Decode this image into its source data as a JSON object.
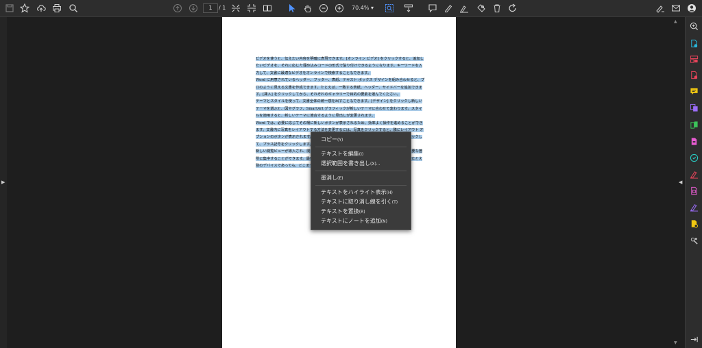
{
  "toolbar": {
    "page_current": "1",
    "page_total": "/ 1",
    "zoom_level": "70.4%",
    "zoom_caret": "▾"
  },
  "document": {
    "paragraphs": [
      "ビデオを使うと、伝えたい内容を明確に表現できます。[オンライン ビデオ] をクリックすると、追加したいビデオを、それに応じた埋め込みコードの形式で貼り付けできるようになります。キーワードを入力して、文書に最適なビデオをオンラインで検索することもできます。",
      "Word に用意されているヘッダー、フッター、表紙、テキスト ボックス デザインを組み合わせると、プロのように見える文書を作成できます。たとえば、一致する表紙、ヘッダー、サイドバーを追加できます。[挿入] をクリックしてから、それぞれのギャラリーで目的の要素を選んでください。",
      "テーマとスタイルを使って、文書全体の統一感を出すこともできます。[デザイン] をクリックし新しいテーマを選ぶと、図やグラフ、SmartArt グラフィックが新しいテーマに合わせて変わります。スタイルを適用すると、新しいテーマに適合するように見出しが変更されます。",
      "Word では、必要に応じてその場に新しいボタンが表示されるため、効率よく操作を進めることができます。文書内に写真をレイアウトする方法を変更するには、写真をクリックすると、隣にレイアウト オプションのボタンが表示されます。表で作業している場合は、行または列を追加する場所をクリックして、プラス記号をクリックします。",
      "新しい閲覧ビューが導入され、閲覧もさらに便利になりました。文書の一部を折りたたんで、必要な箇所に集中することができます。最後まで読み終わる前に中止する必要がある場合、Word では、たとえ別のデバイスであっても、どこまで読んだかが記憶されます。"
    ]
  },
  "context_menu": {
    "items": [
      {
        "label": "コピー",
        "accel": "(Y)"
      },
      {
        "label": "テキストを編集",
        "accel": "(I)"
      },
      {
        "label": "選択範囲を書き出し",
        "accel": "(X)..."
      },
      {
        "label": "墨消し",
        "accel": "(E)"
      },
      {
        "label": "テキストをハイライト表示",
        "accel": "(H)"
      },
      {
        "label": "テキストに取り消し線を引く",
        "accel": "(T)"
      },
      {
        "label": "テキストを置換",
        "accel": "(R)"
      },
      {
        "label": "テキストにノートを追加",
        "accel": "(N)"
      }
    ]
  },
  "colors": {
    "selection": "#a9cbe8",
    "accent": "#4f93ff",
    "toolbar_bg": "#2d2d2d"
  },
  "icons": {
    "left_toolbar": [
      "save-icon",
      "star-icon",
      "cloud-upload-icon",
      "print-icon",
      "search-icon"
    ],
    "right_panel": [
      "zoom-icon",
      "export-pdf-icon",
      "edit-pdf-icon",
      "create-pdf-icon",
      "comment-icon",
      "combine-icon",
      "organize-icon",
      "compress-icon",
      "protect-icon",
      "fill-sign-icon",
      "scan-icon",
      "request-signature-icon",
      "prepare-form-icon",
      "more-tools-icon"
    ]
  }
}
